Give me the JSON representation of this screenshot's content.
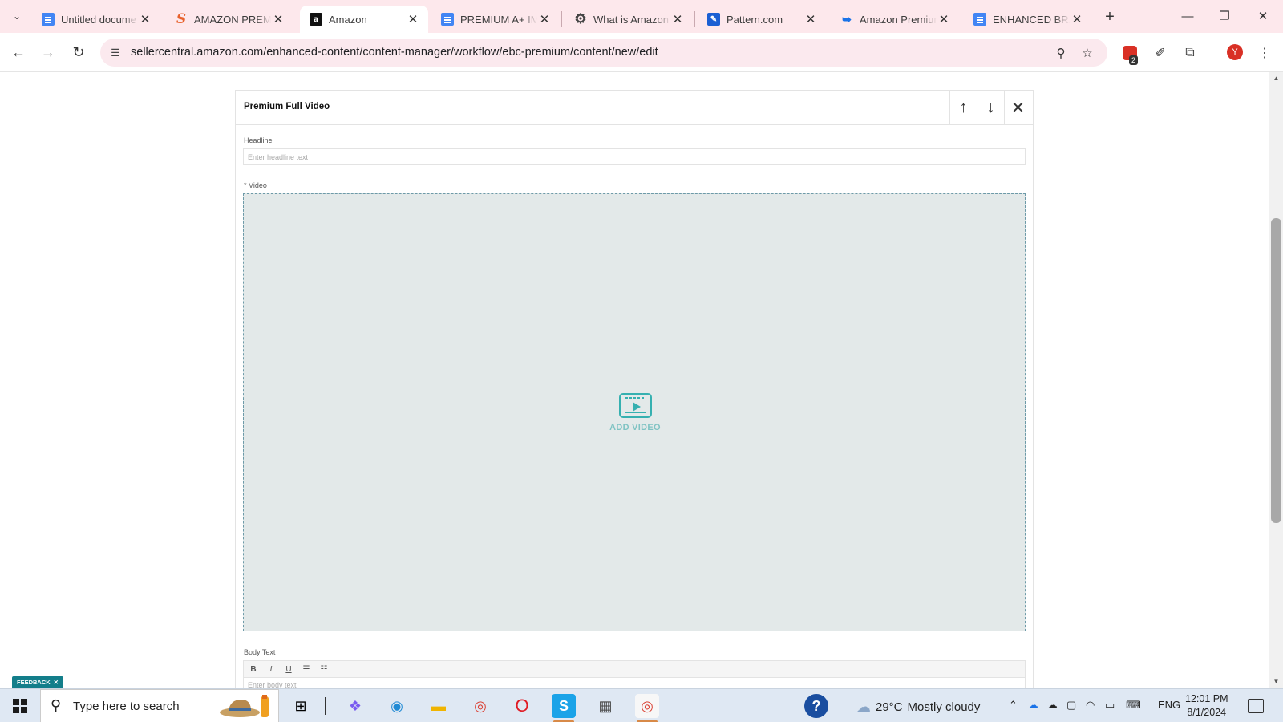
{
  "browser": {
    "tabs": [
      {
        "title": "Untitled docume",
        "favicon": "google-docs-icon",
        "active": false
      },
      {
        "title": "AMAZON PREMI",
        "favicon": "sellerapp-s-icon",
        "active": false
      },
      {
        "title": "Amazon",
        "favicon": "amazon-a-icon",
        "active": true
      },
      {
        "title": "PREMIUM A+ IM",
        "favicon": "google-docs-icon",
        "active": false
      },
      {
        "title": "What is Amazon",
        "favicon": "gear-icon",
        "active": false
      },
      {
        "title": "Pattern.com",
        "favicon": "pattern-icon",
        "active": false
      },
      {
        "title": "Amazon Premiur",
        "favicon": "blog-icon",
        "active": false
      },
      {
        "title": "ENHANCED BRA",
        "favicon": "google-docs-icon",
        "active": false
      }
    ],
    "url": "sellercentral.amazon.com/enhanced-content/content-manager/workflow/ebc-premium/content/new/edit",
    "extension_badge": "2",
    "profile_initial": "Y"
  },
  "module": {
    "title": "Premium Full Video",
    "headline_label": "Headline",
    "headline_placeholder": "Enter headline text",
    "video_label": "* Video",
    "add_video_label": "ADD VIDEO",
    "body_label": "Body Text",
    "body_placeholder": "Enter body text",
    "rte_buttons": [
      "B",
      "I",
      "U"
    ]
  },
  "feedback_label": "FEEDBACK",
  "taskbar": {
    "search_placeholder": "Type here to search",
    "weather_temp": "29°C",
    "weather_desc": "Mostly cloudy",
    "language": "ENG",
    "time": "12:01 PM",
    "date": "8/1/2024"
  },
  "colors": {
    "tabstrip_bg": "#fde8ec",
    "accent_teal": "#35b0b0",
    "drop_zone_bg": "#e3e9e9",
    "feedback_bg": "#137e8a"
  }
}
